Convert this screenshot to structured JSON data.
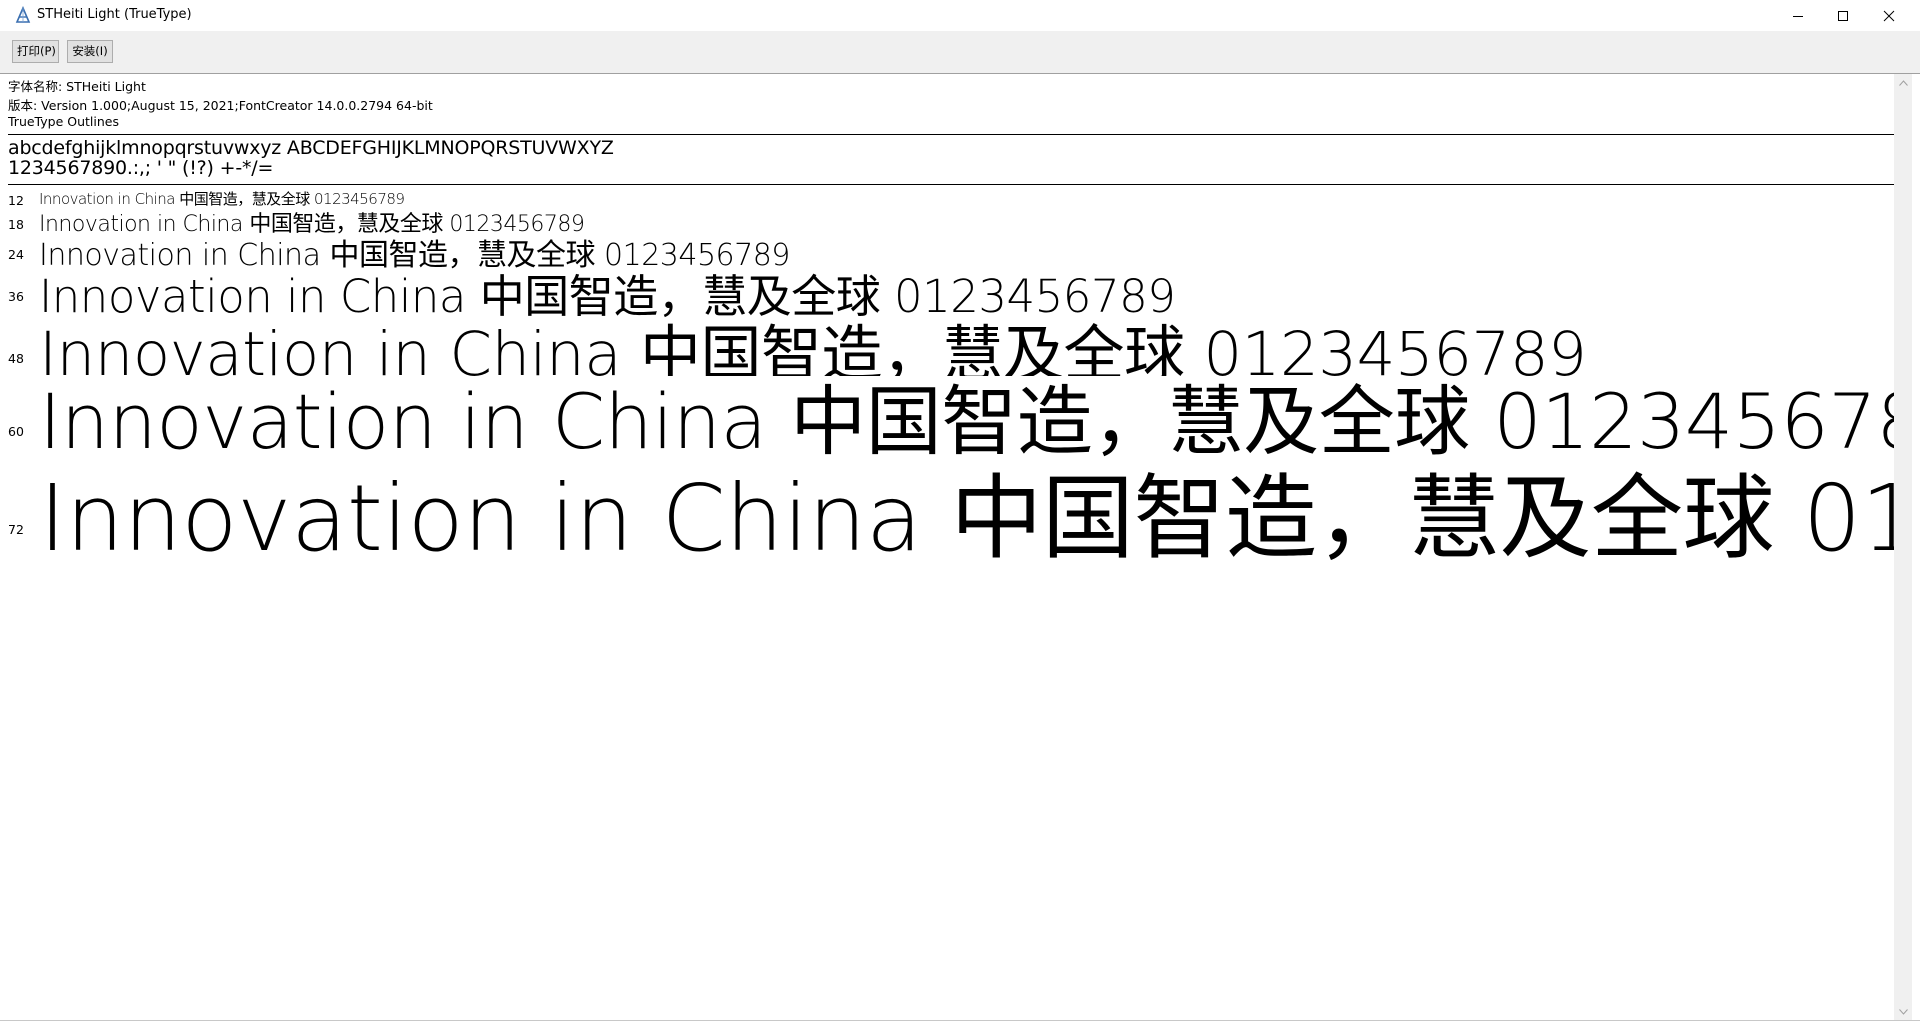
{
  "window": {
    "title": "STHeiti Light (TrueType)",
    "icon": "font-viewer-app-icon",
    "controls": {
      "minimize_icon": "minimize-icon",
      "maximize_icon": "maximize-icon",
      "close_icon": "close-icon"
    }
  },
  "toolbar": {
    "print_label": "打印(P)",
    "install_label": "安装(I)"
  },
  "font_info": {
    "name_line": "字体名称: STHeiti Light",
    "version_line": "版本: Version 1.000;August 15, 2021;FontCreator 14.0.0.2794 64-bit",
    "outline_line": "TrueType Outlines"
  },
  "charset": {
    "line1": "abcdefghijklmnopqrstuvwxyz ABCDEFGHIJKLMNOPQRSTUVWXYZ",
    "line2": "1234567890.:,; ' \" (!?) +-*/="
  },
  "samples": {
    "text": "Innovation in China 中国智造，慧及全球 0123456789",
    "sizes": [
      {
        "label": "12",
        "pt": 12
      },
      {
        "label": "18",
        "pt": 18
      },
      {
        "label": "24",
        "pt": 24
      },
      {
        "label": "36",
        "pt": 36
      },
      {
        "label": "48",
        "pt": 48
      },
      {
        "label": "60",
        "pt": 60
      },
      {
        "label": "72",
        "pt": 72
      }
    ]
  },
  "scrollbar": {
    "up_icon": "scroll-up-arrow-icon",
    "down_icon": "scroll-down-arrow-icon"
  }
}
